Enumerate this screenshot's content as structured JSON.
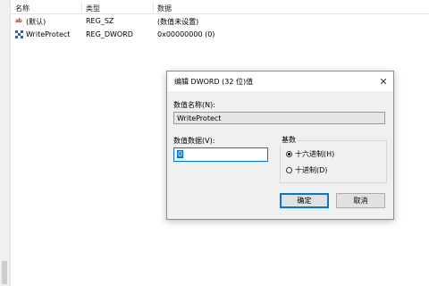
{
  "columns": {
    "name": "名称",
    "type": "类型",
    "data": "数据"
  },
  "rows": [
    {
      "icon": "string-value-icon",
      "name": "(默认)",
      "type": "REG_SZ",
      "data": "(数值未设置)"
    },
    {
      "icon": "dword-value-icon",
      "name": "WriteProtect",
      "type": "REG_DWORD",
      "data": "0x00000000 (0)"
    }
  ],
  "dialog": {
    "title": "编辑 DWORD (32 位)值",
    "name_label": "数值名称(N):",
    "name_value": "WriteProtect",
    "data_label": "数值数据(V):",
    "data_value": "0",
    "base_label": "基数",
    "hex_label": "十六进制(H)",
    "dec_label": "十进制(D)",
    "selected_base": "hex",
    "ok_label": "确定",
    "cancel_label": "取消"
  }
}
